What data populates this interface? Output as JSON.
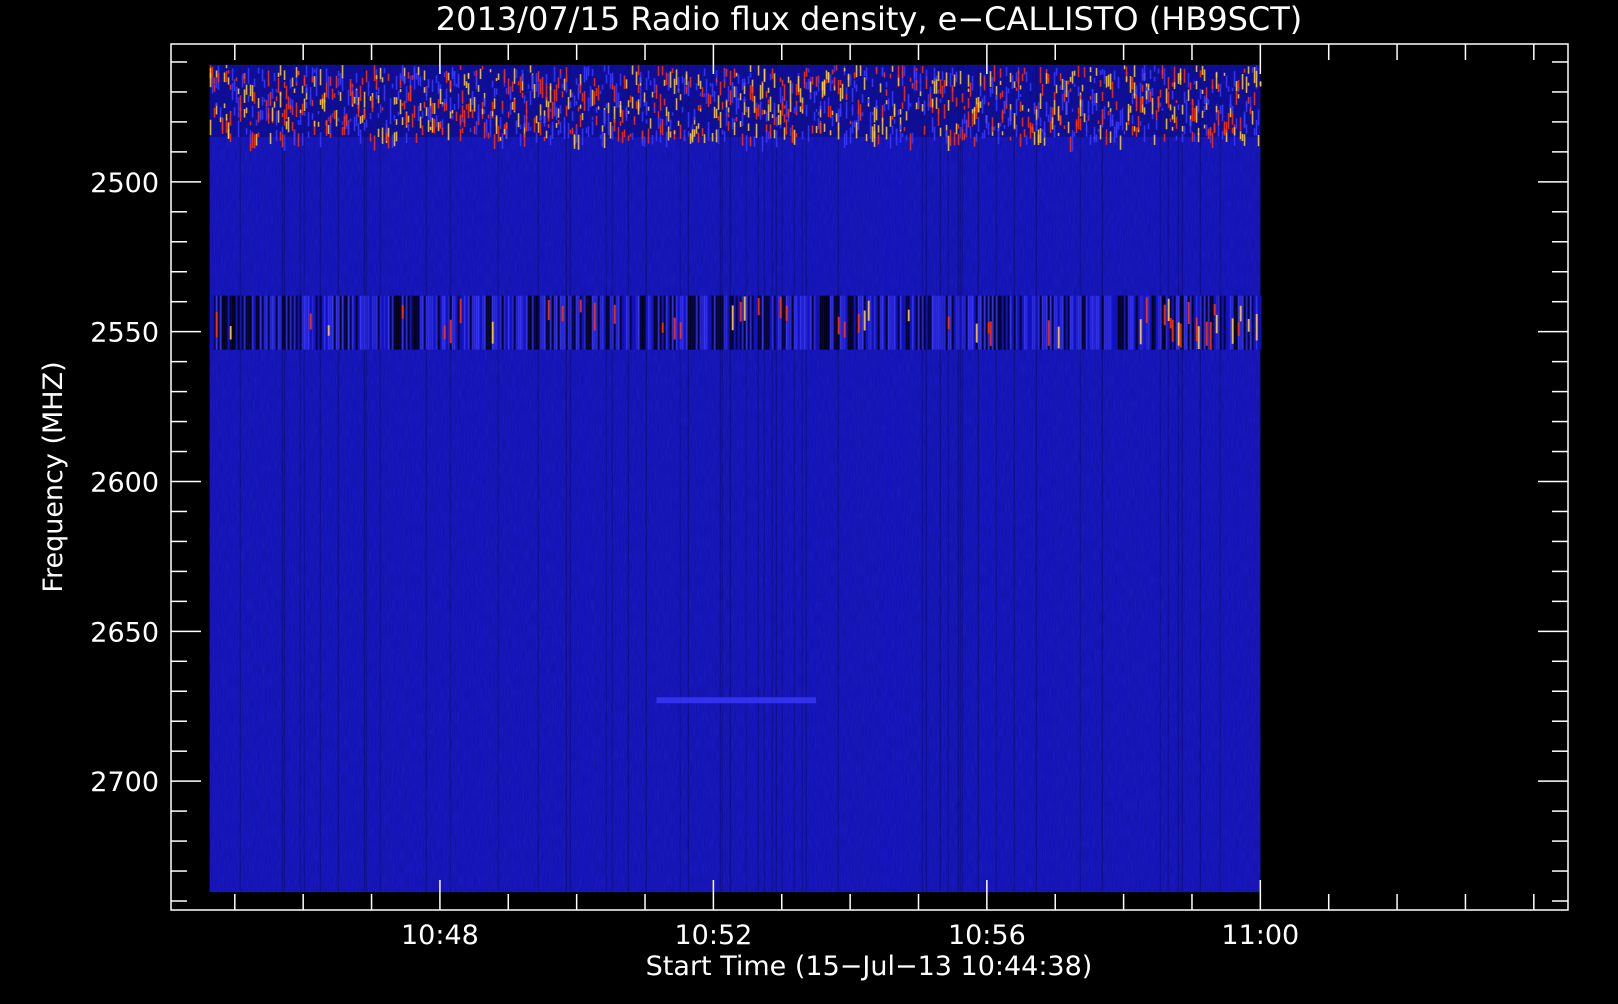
{
  "chart_data": {
    "type": "heatmap",
    "title": "2013/07/15  Radio flux density, e−CALLISTO (HB9SCT)",
    "xlabel": "Start Time (15−Jul−13 10:44:38)",
    "ylabel": "Frequency (MHZ)",
    "x_axis": {
      "unit": "time",
      "range": [
        "10:44:04",
        "11:04:30"
      ],
      "ticks": [
        {
          "value": "10:48",
          "label": "10:48"
        },
        {
          "value": "10:52",
          "label": "10:52"
        },
        {
          "value": "10:56",
          "label": "10:56"
        },
        {
          "value": "11:00",
          "label": "11:00"
        }
      ],
      "minor_tick_step_minutes": 1
    },
    "y_axis": {
      "unit": "MHz",
      "range": [
        2454,
        2743
      ],
      "inverted": true,
      "ticks": [
        2500,
        2550,
        2600,
        2650,
        2700
      ],
      "minor_tick_step": 10
    },
    "data_extent": {
      "time_start": "10:44:38",
      "time_end": "11:00:00",
      "freq_min": 2461,
      "freq_max": 2737
    },
    "colormap": [
      "#000000",
      "#0a0a7a",
      "#1414d2",
      "#3a3aff",
      "#ff3300",
      "#ffcc33"
    ],
    "background_color": "#1111a8",
    "features": [
      {
        "name": "interference band",
        "freq_range": [
          2461,
          2485
        ],
        "intensity": "high"
      },
      {
        "name": "burst band",
        "freq_range": [
          2538,
          2556
        ],
        "intensity": "medium"
      },
      {
        "name": "faint line",
        "freq_range": [
          2672,
          2674
        ],
        "time_range": [
          "10:51:10",
          "10:53:30"
        ],
        "intensity": "low"
      }
    ]
  }
}
